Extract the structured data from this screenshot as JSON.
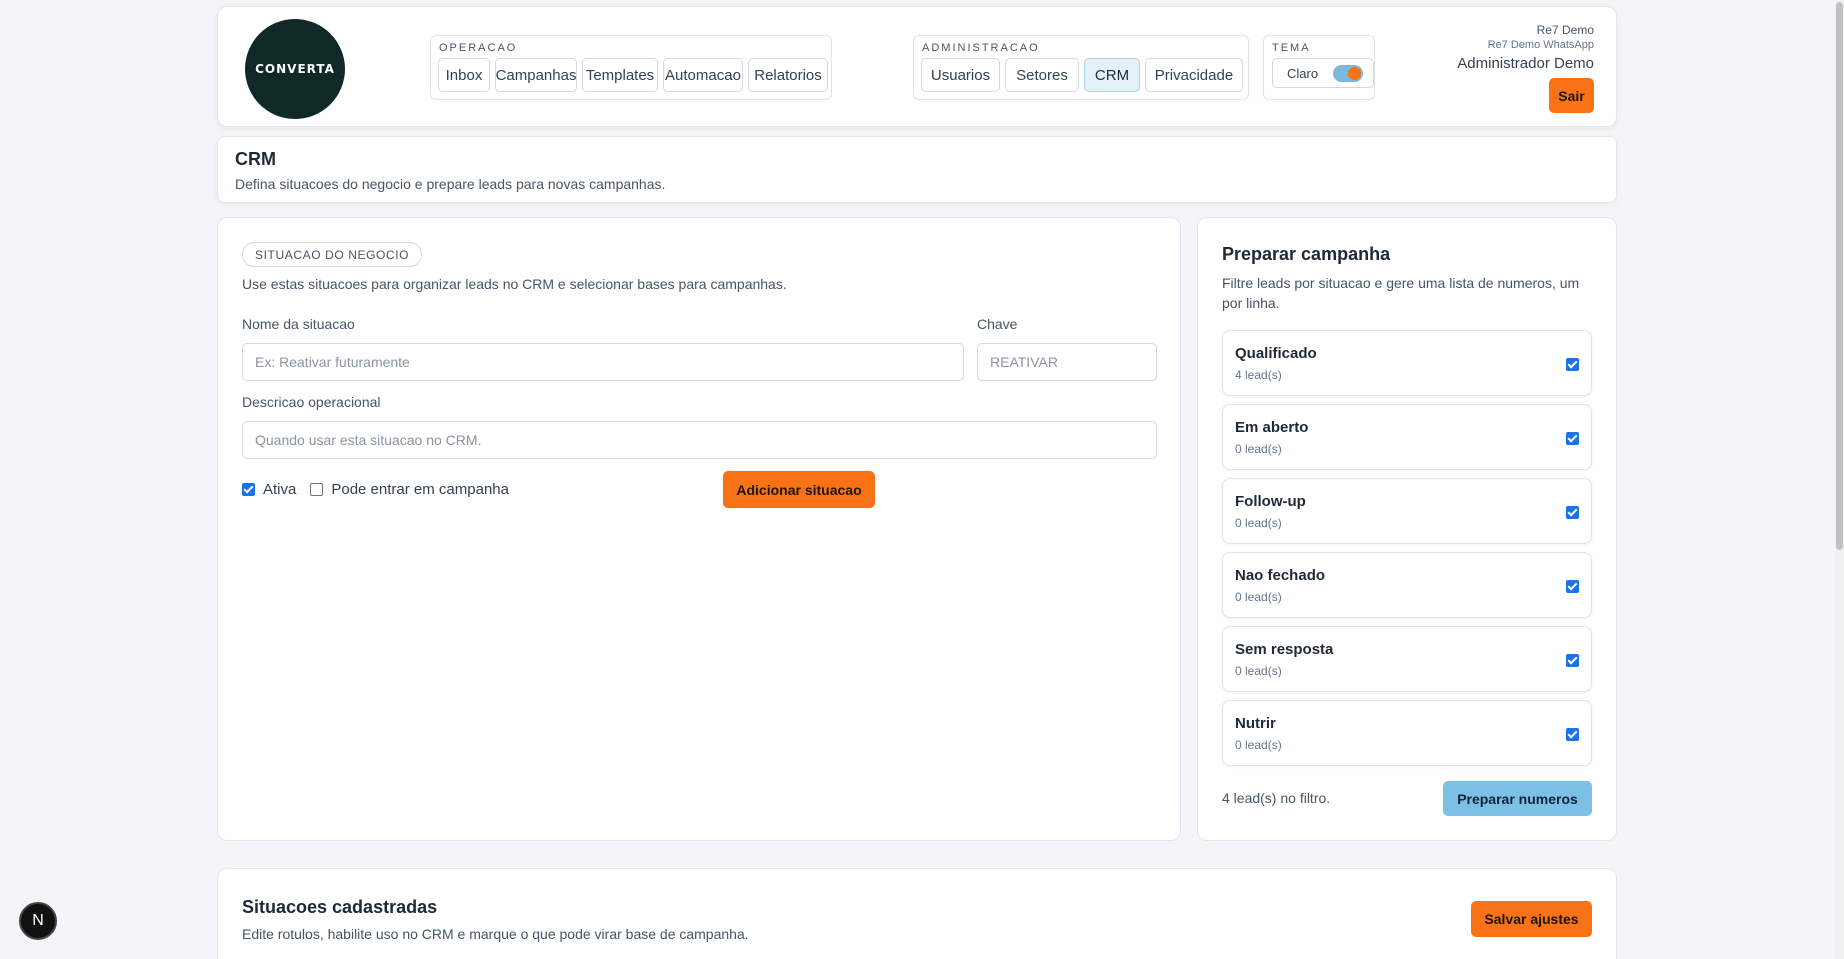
{
  "header": {
    "logo_text": "CONVERTA",
    "operacao": {
      "label": "OPERACAO",
      "items": [
        "Inbox",
        "Campanhas",
        "Templates",
        "Automacao",
        "Relatorios"
      ]
    },
    "administracao": {
      "label": "ADMINISTRACAO",
      "items": [
        "Usuarios",
        "Setores",
        "CRM",
        "Privacidade"
      ],
      "active": "CRM"
    },
    "tema": {
      "label": "TEMA",
      "value": "Claro",
      "toggle_on": true
    },
    "user": {
      "org": "Re7 Demo",
      "account": "Re7 Demo WhatsApp",
      "role": "Administrador Demo",
      "logout_label": "Sair"
    }
  },
  "page": {
    "title": "CRM",
    "subtitle": "Defina situacoes do negocio e prepare leads para novas campanhas."
  },
  "situacao_form": {
    "badge": "SITUACAO DO NEGOCIO",
    "description": "Use estas situacoes para organizar leads no CRM e selecionar bases para campanhas.",
    "nome_label": "Nome da situacao",
    "nome_placeholder": "Ex: Reativar futuramente",
    "chave_label": "Chave",
    "chave_placeholder": "REATIVAR",
    "descricao_label": "Descricao operacional",
    "descricao_placeholder": "Quando usar esta situacao no CRM.",
    "ativa_label": "Ativa",
    "ativa_checked": true,
    "campanha_label": "Pode entrar em campanha",
    "campanha_checked": false,
    "add_button": "Adicionar situacao"
  },
  "preparar": {
    "title": "Preparar campanha",
    "description": "Filtre leads por situacao e gere uma lista de numeros, um por linha.",
    "statuses": [
      {
        "name": "Qualificado",
        "count": "4 lead(s)",
        "checked": true
      },
      {
        "name": "Em aberto",
        "count": "0 lead(s)",
        "checked": true
      },
      {
        "name": "Follow-up",
        "count": "0 lead(s)",
        "checked": true
      },
      {
        "name": "Nao fechado",
        "count": "0 lead(s)",
        "checked": true
      },
      {
        "name": "Sem resposta",
        "count": "0 lead(s)",
        "checked": true
      },
      {
        "name": "Nutrir",
        "count": "0 lead(s)",
        "checked": true
      }
    ],
    "filter_summary": "4 lead(s) no filtro.",
    "prepare_button": "Preparar numeros"
  },
  "cadastradas": {
    "title": "Situacoes cadastradas",
    "description": "Edite rotulos, habilite uso no CRM e marque o que pode virar base de campanha.",
    "save_button": "Salvar ajustes"
  },
  "dev_badge": "N",
  "colors": {
    "accent": "#f97316",
    "active_tab": "#e3f1f9",
    "prepare_button": "#7cc0e6",
    "logo_bg": "#0f2a26"
  }
}
